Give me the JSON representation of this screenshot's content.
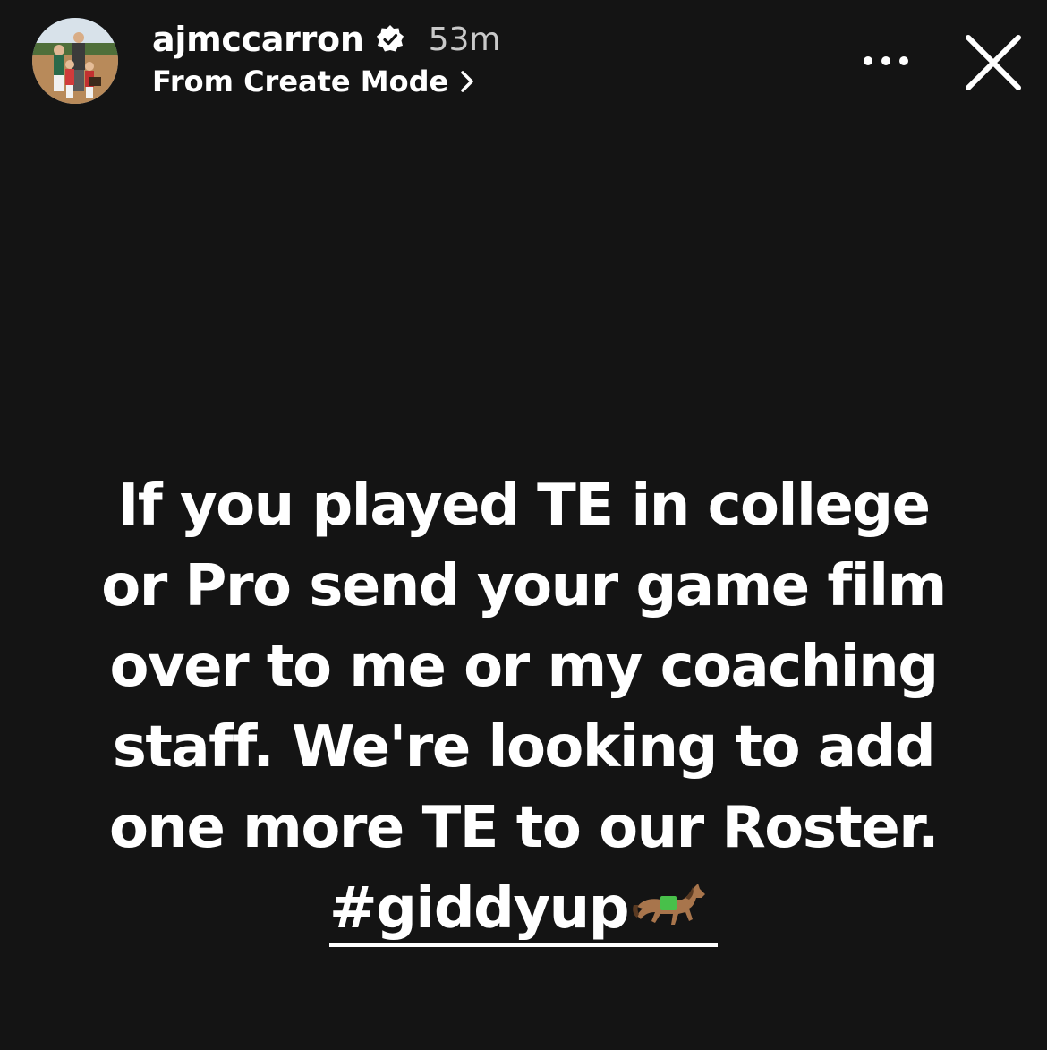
{
  "header": {
    "username": "ajmccarron",
    "timestamp": "53m",
    "subtitle": "From Create Mode",
    "avatar_icon": "profile-photo",
    "verified_icon": "verified-badge-icon",
    "subtitle_icon": "chevron-right-icon",
    "more_icon": "more-horizontal-icon",
    "close_icon": "close-icon"
  },
  "story": {
    "lines": [
      "If you played TE in college",
      "or Pro send your game film",
      "over to me or my coaching",
      "staff. We're looking to add",
      "one more TE to our Roster."
    ],
    "hashtag": "#giddyup",
    "hashtag_emoji_icon": "horse-icon"
  },
  "colors": {
    "background": "#141414",
    "text": "#ffffff",
    "timestamp": "#c9c9c9"
  }
}
